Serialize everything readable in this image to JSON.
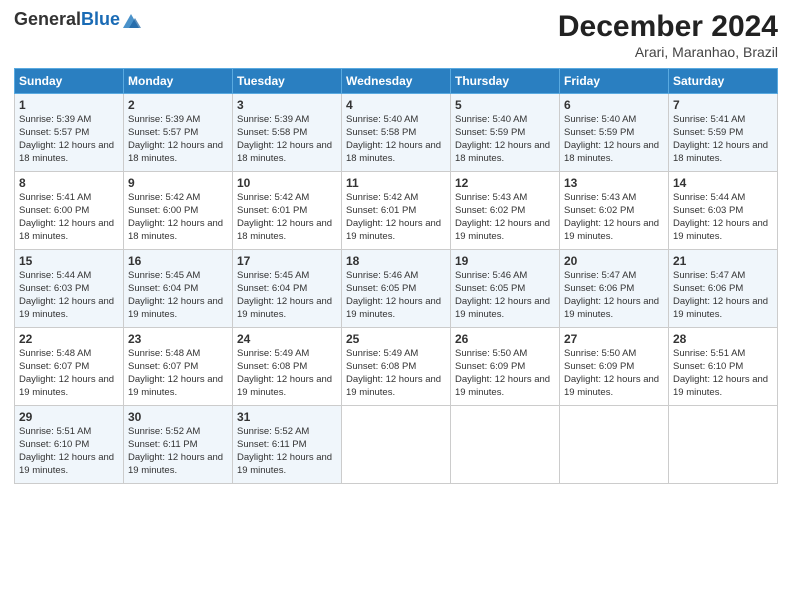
{
  "header": {
    "logo_line1": "General",
    "logo_line2": "Blue",
    "month": "December 2024",
    "location": "Arari, Maranhao, Brazil"
  },
  "days_of_week": [
    "Sunday",
    "Monday",
    "Tuesday",
    "Wednesday",
    "Thursday",
    "Friday",
    "Saturday"
  ],
  "weeks": [
    [
      {
        "day": 1,
        "sunrise": "5:39 AM",
        "sunset": "5:57 PM",
        "daylight": "12 hours and 18 minutes."
      },
      {
        "day": 2,
        "sunrise": "5:39 AM",
        "sunset": "5:57 PM",
        "daylight": "12 hours and 18 minutes."
      },
      {
        "day": 3,
        "sunrise": "5:39 AM",
        "sunset": "5:58 PM",
        "daylight": "12 hours and 18 minutes."
      },
      {
        "day": 4,
        "sunrise": "5:40 AM",
        "sunset": "5:58 PM",
        "daylight": "12 hours and 18 minutes."
      },
      {
        "day": 5,
        "sunrise": "5:40 AM",
        "sunset": "5:59 PM",
        "daylight": "12 hours and 18 minutes."
      },
      {
        "day": 6,
        "sunrise": "5:40 AM",
        "sunset": "5:59 PM",
        "daylight": "12 hours and 18 minutes."
      },
      {
        "day": 7,
        "sunrise": "5:41 AM",
        "sunset": "5:59 PM",
        "daylight": "12 hours and 18 minutes."
      }
    ],
    [
      {
        "day": 8,
        "sunrise": "5:41 AM",
        "sunset": "6:00 PM",
        "daylight": "12 hours and 18 minutes."
      },
      {
        "day": 9,
        "sunrise": "5:42 AM",
        "sunset": "6:00 PM",
        "daylight": "12 hours and 18 minutes."
      },
      {
        "day": 10,
        "sunrise": "5:42 AM",
        "sunset": "6:01 PM",
        "daylight": "12 hours and 18 minutes."
      },
      {
        "day": 11,
        "sunrise": "5:42 AM",
        "sunset": "6:01 PM",
        "daylight": "12 hours and 19 minutes."
      },
      {
        "day": 12,
        "sunrise": "5:43 AM",
        "sunset": "6:02 PM",
        "daylight": "12 hours and 19 minutes."
      },
      {
        "day": 13,
        "sunrise": "5:43 AM",
        "sunset": "6:02 PM",
        "daylight": "12 hours and 19 minutes."
      },
      {
        "day": 14,
        "sunrise": "5:44 AM",
        "sunset": "6:03 PM",
        "daylight": "12 hours and 19 minutes."
      }
    ],
    [
      {
        "day": 15,
        "sunrise": "5:44 AM",
        "sunset": "6:03 PM",
        "daylight": "12 hours and 19 minutes."
      },
      {
        "day": 16,
        "sunrise": "5:45 AM",
        "sunset": "6:04 PM",
        "daylight": "12 hours and 19 minutes."
      },
      {
        "day": 17,
        "sunrise": "5:45 AM",
        "sunset": "6:04 PM",
        "daylight": "12 hours and 19 minutes."
      },
      {
        "day": 18,
        "sunrise": "5:46 AM",
        "sunset": "6:05 PM",
        "daylight": "12 hours and 19 minutes."
      },
      {
        "day": 19,
        "sunrise": "5:46 AM",
        "sunset": "6:05 PM",
        "daylight": "12 hours and 19 minutes."
      },
      {
        "day": 20,
        "sunrise": "5:47 AM",
        "sunset": "6:06 PM",
        "daylight": "12 hours and 19 minutes."
      },
      {
        "day": 21,
        "sunrise": "5:47 AM",
        "sunset": "6:06 PM",
        "daylight": "12 hours and 19 minutes."
      }
    ],
    [
      {
        "day": 22,
        "sunrise": "5:48 AM",
        "sunset": "6:07 PM",
        "daylight": "12 hours and 19 minutes."
      },
      {
        "day": 23,
        "sunrise": "5:48 AM",
        "sunset": "6:07 PM",
        "daylight": "12 hours and 19 minutes."
      },
      {
        "day": 24,
        "sunrise": "5:49 AM",
        "sunset": "6:08 PM",
        "daylight": "12 hours and 19 minutes."
      },
      {
        "day": 25,
        "sunrise": "5:49 AM",
        "sunset": "6:08 PM",
        "daylight": "12 hours and 19 minutes."
      },
      {
        "day": 26,
        "sunrise": "5:50 AM",
        "sunset": "6:09 PM",
        "daylight": "12 hours and 19 minutes."
      },
      {
        "day": 27,
        "sunrise": "5:50 AM",
        "sunset": "6:09 PM",
        "daylight": "12 hours and 19 minutes."
      },
      {
        "day": 28,
        "sunrise": "5:51 AM",
        "sunset": "6:10 PM",
        "daylight": "12 hours and 19 minutes."
      }
    ],
    [
      {
        "day": 29,
        "sunrise": "5:51 AM",
        "sunset": "6:10 PM",
        "daylight": "12 hours and 19 minutes."
      },
      {
        "day": 30,
        "sunrise": "5:52 AM",
        "sunset": "6:11 PM",
        "daylight": "12 hours and 19 minutes."
      },
      {
        "day": 31,
        "sunrise": "5:52 AM",
        "sunset": "6:11 PM",
        "daylight": "12 hours and 19 minutes."
      },
      null,
      null,
      null,
      null
    ]
  ]
}
